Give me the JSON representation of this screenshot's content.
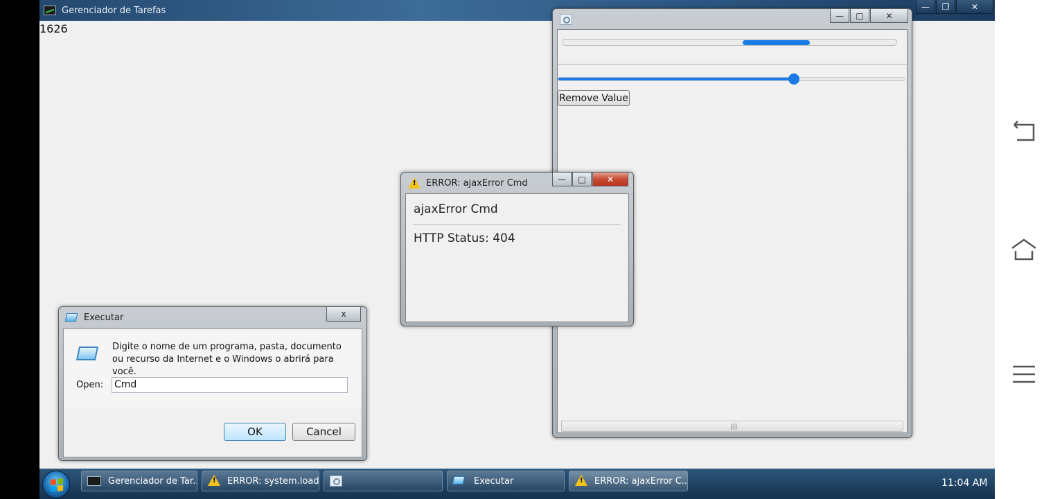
{
  "taskmanager": {
    "title": "Gerenciador de Tarefas",
    "counter": "1626"
  },
  "top_caps": {
    "minimize": "—",
    "restore": "❐",
    "close": "✕"
  },
  "slider_window": {
    "caps": {
      "minimize": "—",
      "maximize": "□",
      "close": "✕"
    },
    "progress_chunk_start_fraction": 0.54,
    "progress_chunk_end_fraction": 0.74,
    "slider_fraction": 0.68,
    "remove_button_label": "Remove Value",
    "scroll_grip": "|||"
  },
  "error_dialog": {
    "title": "ERROR: ajaxError Cmd",
    "heading": "ajaxError Cmd",
    "status": "HTTP Status: 404",
    "caps": {
      "minimize": "—",
      "maximize": "□",
      "close": "✕"
    }
  },
  "run_dialog": {
    "title": "Executar",
    "close_label": "x",
    "description": "Digite o nome de um programa, pasta, documento ou recurso da Internet e o Windows o abrirá para você.",
    "open_label": "Open:",
    "open_value": "Cmd",
    "ok_label": "OK",
    "cancel_label": "Cancel"
  },
  "taskbar": {
    "items": [
      {
        "label": "Gerenciador de Tar...",
        "icon": "task-manager-icon"
      },
      {
        "label": "ERROR: system.load...",
        "icon": "warning-icon"
      },
      {
        "label": "",
        "icon": "magnifier-icon"
      },
      {
        "label": "Executar",
        "icon": "run-icon"
      },
      {
        "label": "ERROR: ajaxError C...",
        "icon": "warning-icon"
      }
    ],
    "clock": "11:04 AM"
  },
  "colors": {
    "accent": "#1a7be6",
    "close_red": "#c84a32",
    "taskbar": "#1f4466"
  }
}
